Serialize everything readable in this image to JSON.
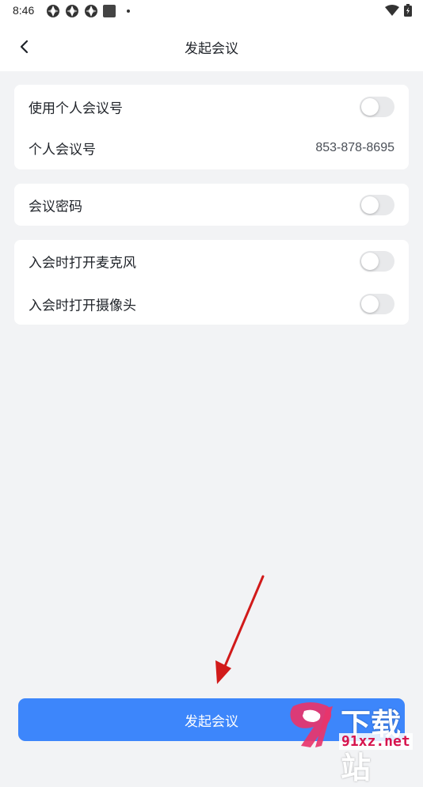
{
  "status_bar": {
    "time": "8:46"
  },
  "nav": {
    "title": "发起会议"
  },
  "personal_meeting_card": {
    "use_personal_label": "使用个人会议号",
    "use_personal_on": false,
    "personal_id_label": "个人会议号",
    "personal_id_value": "853-878-8695"
  },
  "password_card": {
    "password_label": "会议密码",
    "password_on": false
  },
  "media_card": {
    "mic_label": "入会时打开麦克风",
    "mic_on": false,
    "camera_label": "入会时打开摄像头",
    "camera_on": false
  },
  "footer": {
    "start_button_label": "发起会议"
  },
  "watermark": {
    "brand_top": "下载站",
    "brand_bottom": "91xz.net"
  },
  "colors": {
    "accent": "#3d86fb",
    "background": "#f2f3f5",
    "annotation_arrow": "#d11a1a"
  }
}
